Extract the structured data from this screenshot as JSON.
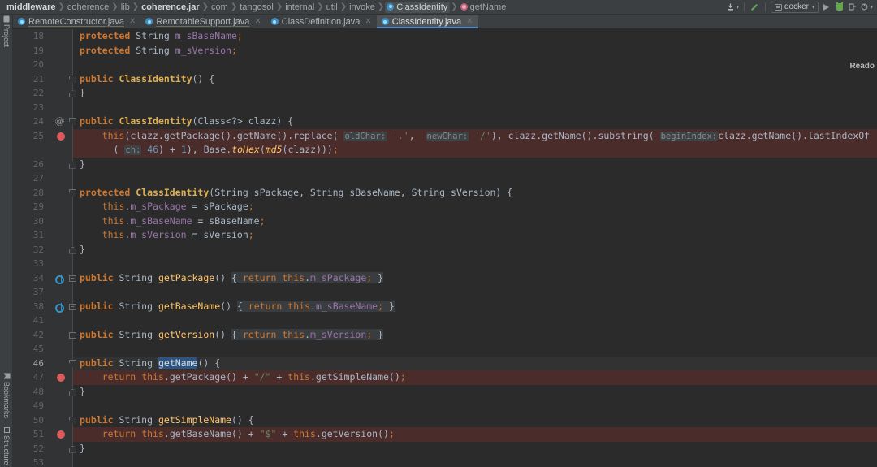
{
  "window": {
    "breadcrumb": [
      {
        "label": "middleware",
        "style": "bold"
      },
      {
        "label": "coherence",
        "style": "normal"
      },
      {
        "label": "lib",
        "style": "normal"
      },
      {
        "label": "coherence.jar",
        "style": "bold"
      },
      {
        "label": "com",
        "style": "normal"
      },
      {
        "label": "tangosol",
        "style": "normal"
      },
      {
        "label": "internal",
        "style": "normal"
      },
      {
        "label": "util",
        "style": "normal"
      },
      {
        "label": "invoke",
        "style": "normal"
      },
      {
        "label": "ClassIdentity",
        "style": "class"
      },
      {
        "label": "getName",
        "style": "method"
      }
    ]
  },
  "toolbar": {
    "vcs_update_label": "vcs-update",
    "build_label": "build-hammer",
    "run_config_name": "docker",
    "run_label": "run",
    "debug_label": "debug",
    "stop_label": "stop",
    "more_label": "more"
  },
  "left_sidebar": {
    "project_label": "Project",
    "bookmarks_label": "Bookmarks",
    "structure_label": "Structure"
  },
  "tabs": [
    {
      "label": "RemoteConstructor.java",
      "active": false
    },
    {
      "label": "RemotableSupport.java",
      "active": false
    },
    {
      "label": "ClassDefinition.java",
      "active": false
    },
    {
      "label": "ClassIdentity.java",
      "active": true
    }
  ],
  "editor": {
    "readonly_notice": "Reado",
    "current_line": 46,
    "selected_word": "getName",
    "lines": [
      {
        "n": 18,
        "breakpoint": false
      },
      {
        "n": 19,
        "breakpoint": false
      },
      {
        "n": 20,
        "breakpoint": false
      },
      {
        "n": 21,
        "breakpoint": false,
        "fold": "top"
      },
      {
        "n": 22,
        "breakpoint": false,
        "fold": "bottom"
      },
      {
        "n": 23,
        "breakpoint": false
      },
      {
        "n": 24,
        "breakpoint": false,
        "annotation": "@",
        "fold": "top"
      },
      {
        "n": 25,
        "breakpoint": true
      },
      {
        "n": "",
        "breakpoint": false
      },
      {
        "n": 26,
        "breakpoint": false,
        "fold": "bottom"
      },
      {
        "n": 27,
        "breakpoint": false
      },
      {
        "n": 28,
        "breakpoint": false,
        "fold": "top"
      },
      {
        "n": 29,
        "breakpoint": false
      },
      {
        "n": 30,
        "breakpoint": false
      },
      {
        "n": 31,
        "breakpoint": false
      },
      {
        "n": 32,
        "breakpoint": false,
        "fold": "bottom"
      },
      {
        "n": 33,
        "breakpoint": false
      },
      {
        "n": 34,
        "breakpoint": false,
        "override": true,
        "fold": "collapsed"
      },
      {
        "n": 37,
        "breakpoint": false
      },
      {
        "n": 38,
        "breakpoint": false,
        "override": true,
        "fold": "collapsed"
      },
      {
        "n": 41,
        "breakpoint": false
      },
      {
        "n": 42,
        "breakpoint": false,
        "fold": "collapsed"
      },
      {
        "n": 45,
        "breakpoint": false
      },
      {
        "n": 46,
        "breakpoint": false,
        "fold": "top",
        "current": true
      },
      {
        "n": 47,
        "breakpoint": true
      },
      {
        "n": 48,
        "breakpoint": false,
        "fold": "bottom"
      },
      {
        "n": 49,
        "breakpoint": false
      },
      {
        "n": 50,
        "breakpoint": false,
        "fold": "top"
      },
      {
        "n": 51,
        "breakpoint": true
      },
      {
        "n": 52,
        "breakpoint": false,
        "fold": "bottom"
      },
      {
        "n": 53,
        "breakpoint": false
      }
    ],
    "code_text": [
      "protected String m_sBaseName;",
      "protected String m_sVersion;",
      "",
      "public ClassIdentity() {",
      "}",
      "",
      "public ClassIdentity(Class<?> clazz) {",
      "    this(clazz.getPackage().getName().replace( oldChar: '.',  newChar: '/'), clazz.getName().substring( beginIndex: clazz.getName().lastIndexOf",
      "      ( ch: 46) + 1), Base.toHex(md5(clazz)));",
      "}",
      "",
      "protected ClassIdentity(String sPackage, String sBaseName, String sVersion) {",
      "    this.m_sPackage = sPackage;",
      "    this.m_sBaseName = sBaseName;",
      "    this.m_sVersion = sVersion;",
      "}",
      "",
      "public String getPackage() { return this.m_sPackage; }",
      "",
      "public String getBaseName() { return this.m_sBaseName; }",
      "",
      "public String getVersion() { return this.m_sVersion; }",
      "",
      "public String getName() {",
      "    return this.getPackage() + \"/\" + this.getSimpleName();",
      "}",
      "",
      "public String getSimpleName() {",
      "    return this.getBaseName() + \"$\" + this.getVersion();",
      "}",
      ""
    ]
  },
  "colors": {
    "background": "#2b2b2b",
    "chrome": "#3c3f41",
    "gutter": "#313335",
    "keyword": "#cc7832",
    "class_name": "#e0b050",
    "field": "#9876aa",
    "method": "#ffc66d",
    "string": "#6a8759",
    "number": "#6897bb",
    "breakpoint": "#db5c5c",
    "error_line": "#4a2c2a",
    "accent": "#4e88c7",
    "selection": "#2f5480"
  }
}
